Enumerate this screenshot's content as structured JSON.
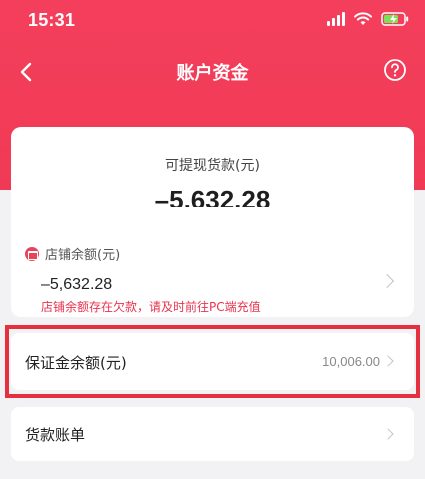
{
  "status_bar": {
    "time": "15:31"
  },
  "nav": {
    "title": "账户资金"
  },
  "summary": {
    "label": "可提现货款(元)",
    "amount": "–5,632.28"
  },
  "shop_balance": {
    "label": "店铺余额(元)",
    "amount": "–5,632.28",
    "warning": "店铺余额存在欠款，请及时前往PC端充值"
  },
  "deposit": {
    "label": "保证金余额(元)",
    "value": "10,006.00"
  },
  "bill": {
    "label": "货款账单"
  },
  "colors": {
    "brand": "#f23d58",
    "warning": "#e8344e",
    "highlight": "#e5303f"
  }
}
